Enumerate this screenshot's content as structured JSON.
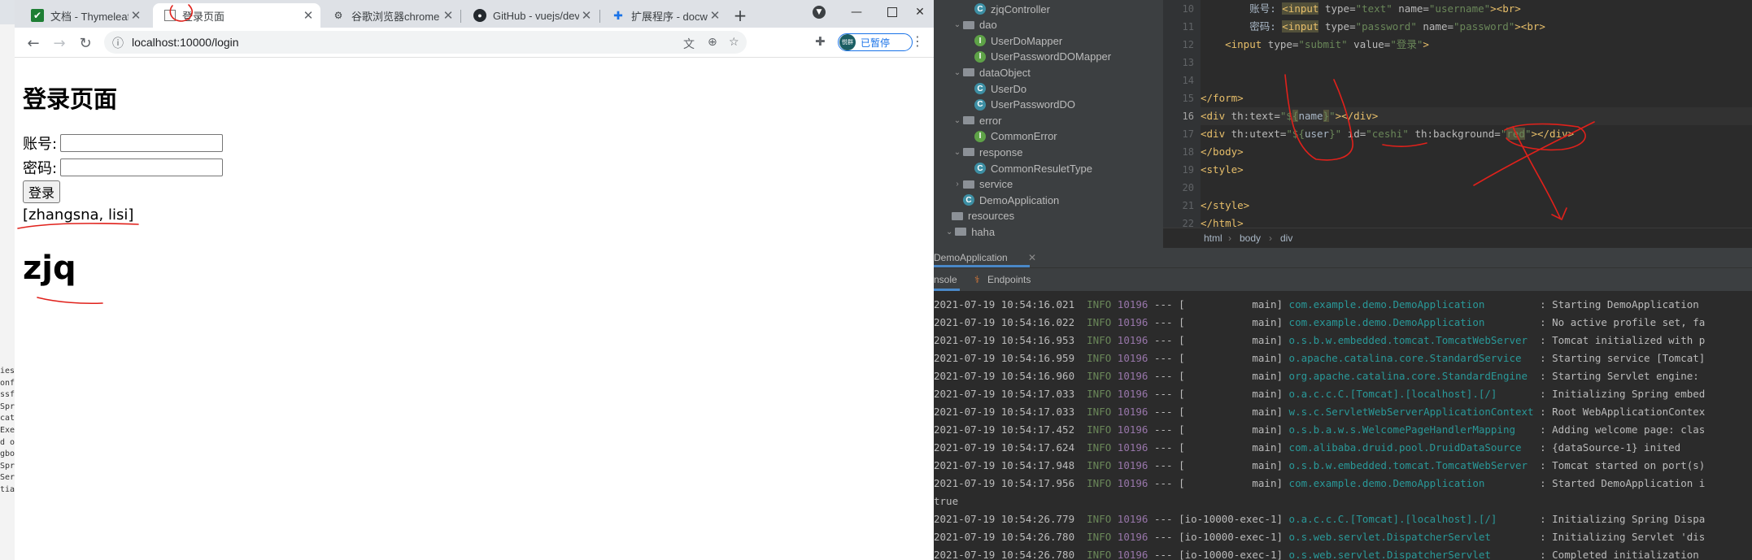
{
  "left_strip": {
    "lines": [
      "ies",
      "onf",
      "ssf",
      "Spr",
      "cat",
      "Exe",
      "d or",
      "gbo",
      "Spr",
      "Ser",
      "tia"
    ]
  },
  "browser": {
    "tabs": [
      {
        "title": "文档 - Thymeleaf",
        "icon": "checkbox-favicon-icon"
      },
      {
        "title": "登录页面",
        "icon": "page-favicon-icon"
      },
      {
        "title": "谷歌浏览器chrome",
        "icon": "gear-favicon-icon"
      },
      {
        "title": "GitHub - vuejs/dev",
        "icon": "github-icon"
      },
      {
        "title": "扩展程序 - docway",
        "icon": "puzzle-icon"
      }
    ],
    "url": "localhost:10000/login",
    "profile_label": "已暂停",
    "avatar_text": "悦群"
  },
  "page": {
    "heading": "登录页面",
    "account_label": "账号:",
    "password_label": "密码:",
    "login_button": "登录",
    "names": "[zhangsna, lisi]",
    "user": "zjq"
  },
  "ide": {
    "tree": [
      {
        "type": "class",
        "kind": "c",
        "label": "zjqController",
        "indent": 3
      },
      {
        "type": "folder",
        "label": "dao",
        "indent": 1,
        "open": true
      },
      {
        "type": "class",
        "kind": "i",
        "label": "UserDoMapper",
        "indent": 3
      },
      {
        "type": "class",
        "kind": "i",
        "label": "UserPasswordDOMapper",
        "indent": 3
      },
      {
        "type": "folder",
        "label": "dataObject",
        "indent": 1,
        "open": true
      },
      {
        "type": "class",
        "kind": "c",
        "label": "UserDo",
        "indent": 3
      },
      {
        "type": "class",
        "kind": "c",
        "label": "UserPasswordDO",
        "indent": 3
      },
      {
        "type": "folder",
        "label": "error",
        "indent": 1,
        "open": true
      },
      {
        "type": "class",
        "kind": "i",
        "label": "CommonError",
        "indent": 3
      },
      {
        "type": "folder",
        "label": "response",
        "indent": 1,
        "open": true
      },
      {
        "type": "class",
        "kind": "c",
        "label": "CommonResuletType",
        "indent": 3
      },
      {
        "type": "folder",
        "label": "service",
        "indent": 1,
        "open": false
      },
      {
        "type": "class",
        "kind": "c",
        "label": "DemoApplication",
        "indent": 2
      },
      {
        "type": "folder",
        "label": "resources",
        "indent": 0,
        "open": null
      },
      {
        "type": "folder",
        "label": "haha",
        "indent": 0.3,
        "open": true
      }
    ],
    "line_numbers": [
      "10",
      "11",
      "12",
      "13",
      "14",
      "15",
      "16",
      "17",
      "18",
      "19",
      "20",
      "21",
      "22"
    ],
    "code": {
      "l10_label": "账号: ",
      "l10_tag": "<input",
      "l10_rest_attr1": " type=",
      "l10_rest_val1": "\"text\"",
      "l10_rest_attr2": " name=",
      "l10_rest_val2": "\"username\"",
      "l10_end": "><br>",
      "l11_label": "密码: ",
      "l11_tag": "<input",
      "l11_attr1": " type=",
      "l11_val1": "\"password\"",
      "l11_attr2": " name=",
      "l11_val2": "\"password\"",
      "l11_end": "><br>",
      "l12_tag": "<input",
      "l12_attr1": " type=",
      "l12_val1": "\"submit\"",
      "l12_attr2": " value=",
      "l12_val2": "\"登录\"",
      "l12_end": ">",
      "l15": "</form>",
      "l16_open": "<div",
      "l16_attr": " th:text=",
      "l16_val_a": "\"$",
      "l16_brace_o": "{",
      "l16_var": "name",
      "l16_brace_c": "}",
      "l16_val_b": "\"",
      "l16_close": "></div>",
      "l17_open": "<div",
      "l17_attr": " th:utext=",
      "l17_val_a": "\"$",
      "l17_brace_o": "{",
      "l17_var": "user",
      "l17_brace_c": "}",
      "l17_val_b": "\"",
      "l17_attr2": " id=",
      "l17_val2": "\"ceshi\"",
      "l17_attr3": " th:background=",
      "l17_q1": "\"",
      "l17_val3": "red",
      "l17_q2": "\"",
      "l17_close": "></div>",
      "l18": "</body>",
      "l19": "<style>",
      "l21": "</style>",
      "l22": "</html>"
    },
    "breadcrumb": [
      "html",
      "body",
      "div"
    ],
    "run_tab": "DemoApplication",
    "subtabs": [
      "nsole",
      "Endpoints"
    ],
    "console": [
      {
        "ts": "2021-07-19 10:54:16.021",
        "level": "INFO",
        "pid": "10196",
        "sep": "---",
        "thread": "[           main]",
        "logger": "com.example.demo.DemoApplication        ",
        "msg": ": Starting DemoApplication"
      },
      {
        "ts": "2021-07-19 10:54:16.022",
        "level": "INFO",
        "pid": "10196",
        "sep": "---",
        "thread": "[           main]",
        "logger": "com.example.demo.DemoApplication        ",
        "msg": ": No active profile set, fa"
      },
      {
        "ts": "2021-07-19 10:54:16.953",
        "level": "INFO",
        "pid": "10196",
        "sep": "---",
        "thread": "[           main]",
        "logger": "o.s.b.w.embedded.tomcat.TomcatWebServer ",
        "msg": ": Tomcat initialized with p"
      },
      {
        "ts": "2021-07-19 10:54:16.959",
        "level": "INFO",
        "pid": "10196",
        "sep": "---",
        "thread": "[           main]",
        "logger": "o.apache.catalina.core.StandardService  ",
        "msg": ": Starting service [Tomcat]"
      },
      {
        "ts": "2021-07-19 10:54:16.960",
        "level": "INFO",
        "pid": "10196",
        "sep": "---",
        "thread": "[           main]",
        "logger": "org.apache.catalina.core.StandardEngine ",
        "msg": ": Starting Servlet engine:"
      },
      {
        "ts": "2021-07-19 10:54:17.033",
        "level": "INFO",
        "pid": "10196",
        "sep": "---",
        "thread": "[           main]",
        "logger": "o.a.c.c.C.[Tomcat].[localhost].[/]      ",
        "msg": ": Initializing Spring embed"
      },
      {
        "ts": "2021-07-19 10:54:17.033",
        "level": "INFO",
        "pid": "10196",
        "sep": "---",
        "thread": "[           main]",
        "logger": "w.s.c.ServletWebServerApplicationContext",
        "msg": ": Root WebApplicationContex"
      },
      {
        "ts": "2021-07-19 10:54:17.452",
        "level": "INFO",
        "pid": "10196",
        "sep": "---",
        "thread": "[           main]",
        "logger": "o.s.b.a.w.s.WelcomePageHandlerMapping   ",
        "msg": ": Adding welcome page: clas"
      },
      {
        "ts": "2021-07-19 10:54:17.624",
        "level": "INFO",
        "pid": "10196",
        "sep": "---",
        "thread": "[           main]",
        "logger": "com.alibaba.druid.pool.DruidDataSource  ",
        "msg": ": {dataSource-1} inited"
      },
      {
        "ts": "2021-07-19 10:54:17.948",
        "level": "INFO",
        "pid": "10196",
        "sep": "---",
        "thread": "[           main]",
        "logger": "o.s.b.w.embedded.tomcat.TomcatWebServer ",
        "msg": ": Tomcat started on port(s)"
      },
      {
        "ts": "2021-07-19 10:54:17.956",
        "level": "INFO",
        "pid": "10196",
        "sep": "---",
        "thread": "[           main]",
        "logger": "com.example.demo.DemoApplication        ",
        "msg": ": Started DemoApplication i"
      },
      {
        "plain": "true"
      },
      {
        "ts": "2021-07-19 10:54:26.779",
        "level": "INFO",
        "pid": "10196",
        "sep": "---",
        "thread": "[io-10000-exec-1]",
        "logger": "o.a.c.c.C.[Tomcat].[localhost].[/]      ",
        "msg": ": Initializing Spring Dispa"
      },
      {
        "ts": "2021-07-19 10:54:26.780",
        "level": "INFO",
        "pid": "10196",
        "sep": "---",
        "thread": "[io-10000-exec-1]",
        "logger": "o.s.web.servlet.DispatcherServlet       ",
        "msg": ": Initializing Servlet 'dis"
      },
      {
        "ts": "2021-07-19 10:54:26.780",
        "level": "INFO",
        "pid": "10196",
        "sep": "---",
        "thread": "[io-10000-exec-1]",
        "logger": "o.s.web.servlet.DispatcherServlet       ",
        "msg": ": Completed initialization"
      }
    ]
  },
  "colors": {
    "annotation": "#e0211b",
    "ide_bg": "#2b2b2b",
    "panel_bg": "#3c3f41",
    "accent": "#1a73e8"
  }
}
